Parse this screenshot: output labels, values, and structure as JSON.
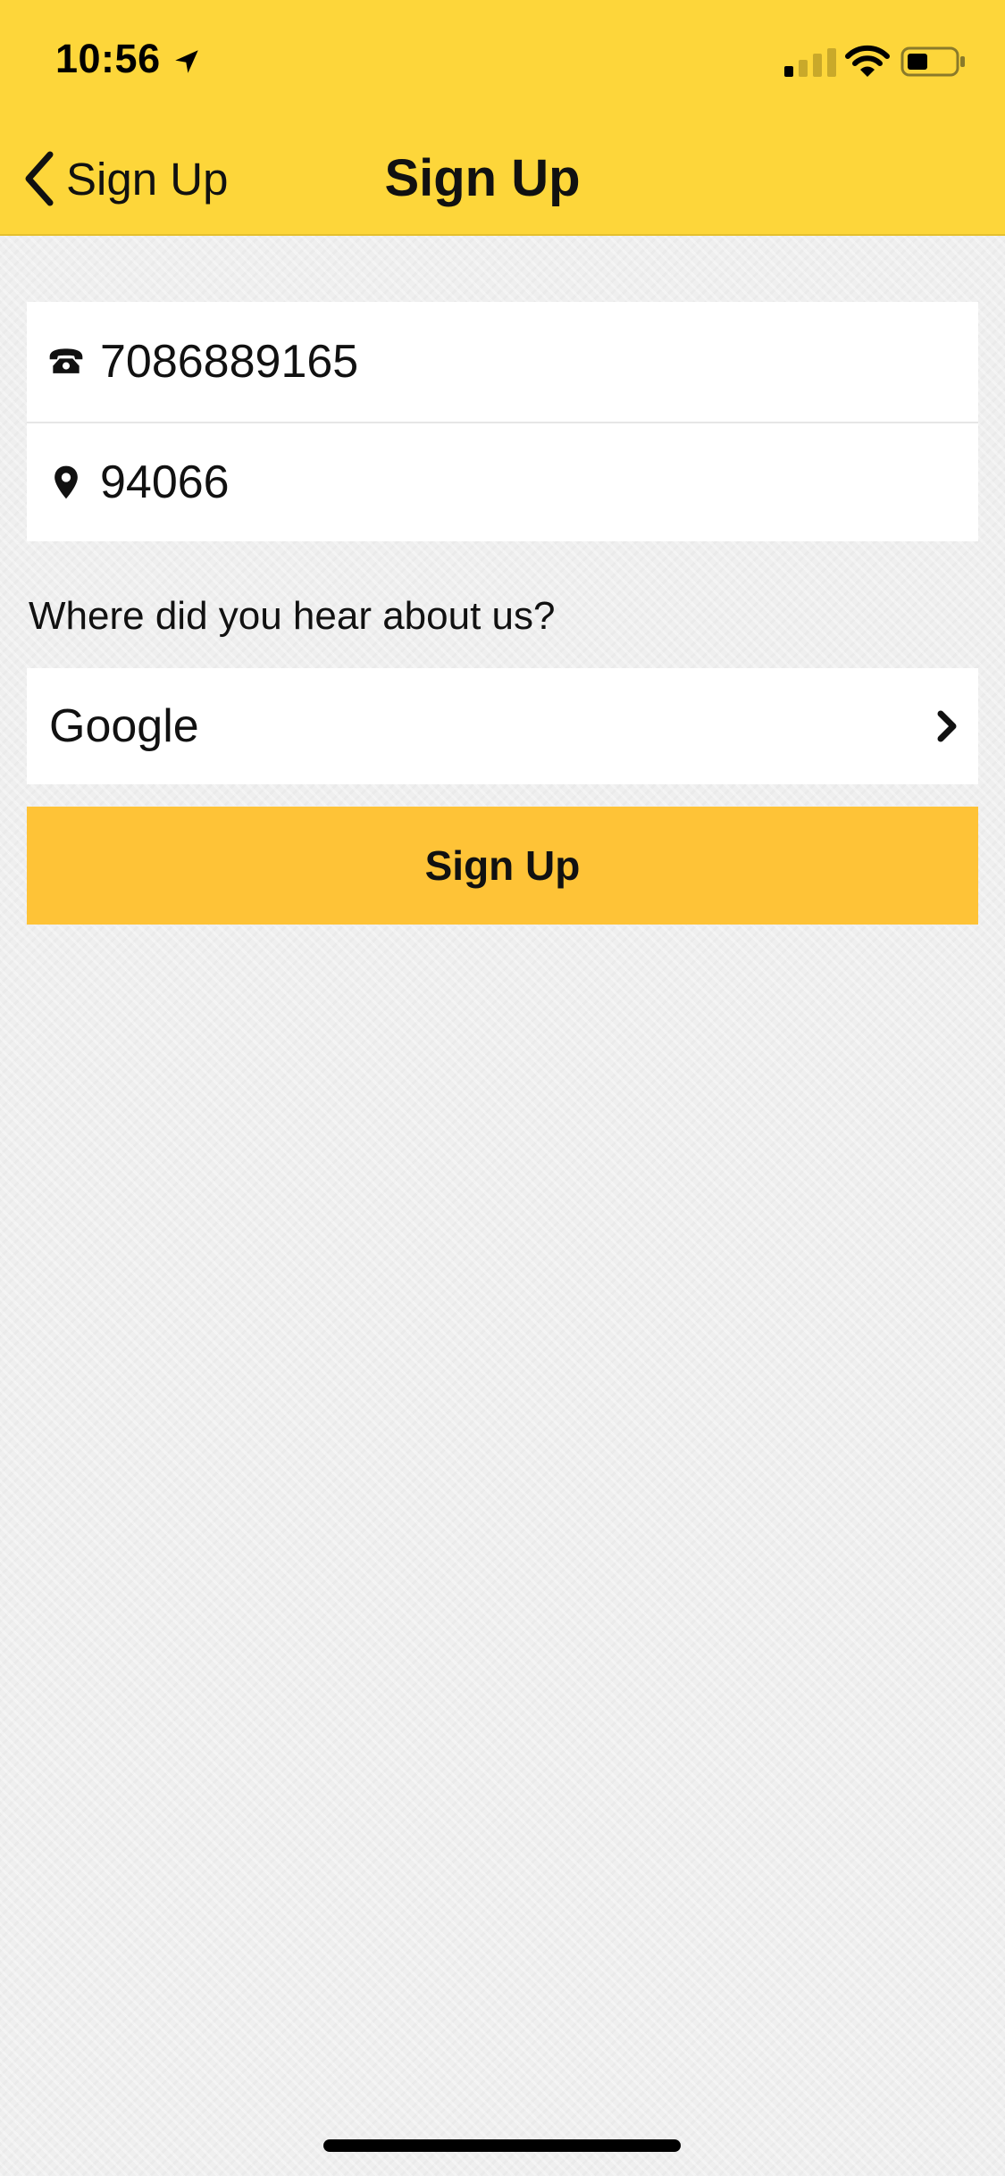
{
  "status_bar": {
    "time": "10:56",
    "icons": [
      "location-arrow-icon",
      "cellular-signal-icon",
      "wifi-icon",
      "battery-icon"
    ]
  },
  "nav": {
    "back_label": "Sign Up",
    "title": "Sign Up"
  },
  "form": {
    "phone": {
      "icon": "phone-icon",
      "value": "7086889165"
    },
    "zip": {
      "icon": "location-pin-icon",
      "value": "94066"
    },
    "referral_label": "Where did you hear about us?",
    "referral_value": "Google",
    "submit_label": "Sign Up"
  },
  "colors": {
    "header_background": "#fdd63a",
    "button_background": "#fec337",
    "page_background": "#efefef"
  }
}
